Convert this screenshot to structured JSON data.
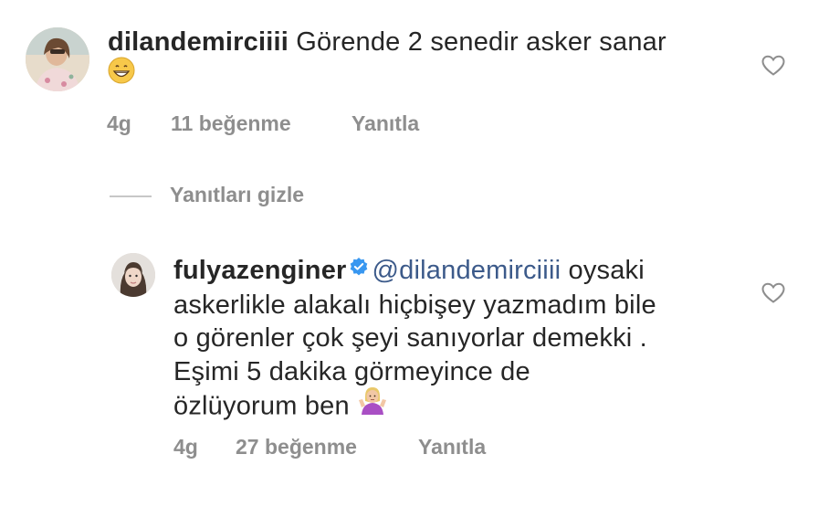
{
  "comments": [
    {
      "username": "dilandemirciiii",
      "text": " Görende 2 senedir asker sanar",
      "time": "4g",
      "likes": "11 beğenme",
      "reply": "Yanıtla"
    },
    {
      "username": "fulyazenginer",
      "mention": "@dilandemirciiii",
      "text_line1": " oysaki",
      "text_line2": "askerlikle alakalı hiçbişey yazmadım bile",
      "text_line3": "o görenler çok şeyi sanıyorlar demekki .",
      "text_line4": "Eşimi 5 dakika görmeyince de",
      "text_line5": "özlüyorum ben",
      "time": "4g",
      "likes": "27 beğenme",
      "reply": "Yanıtla"
    }
  ],
  "replies_toggle": "Yanıtları gizle",
  "colors": {
    "text": "#262626",
    "muted": "#8e8e8e",
    "mention": "#3c5a8a",
    "verified": "#3897f0"
  },
  "icons": [
    "heart-icon",
    "verified-badge-icon",
    "grinning-emoji-icon",
    "shrug-emoji-icon"
  ]
}
